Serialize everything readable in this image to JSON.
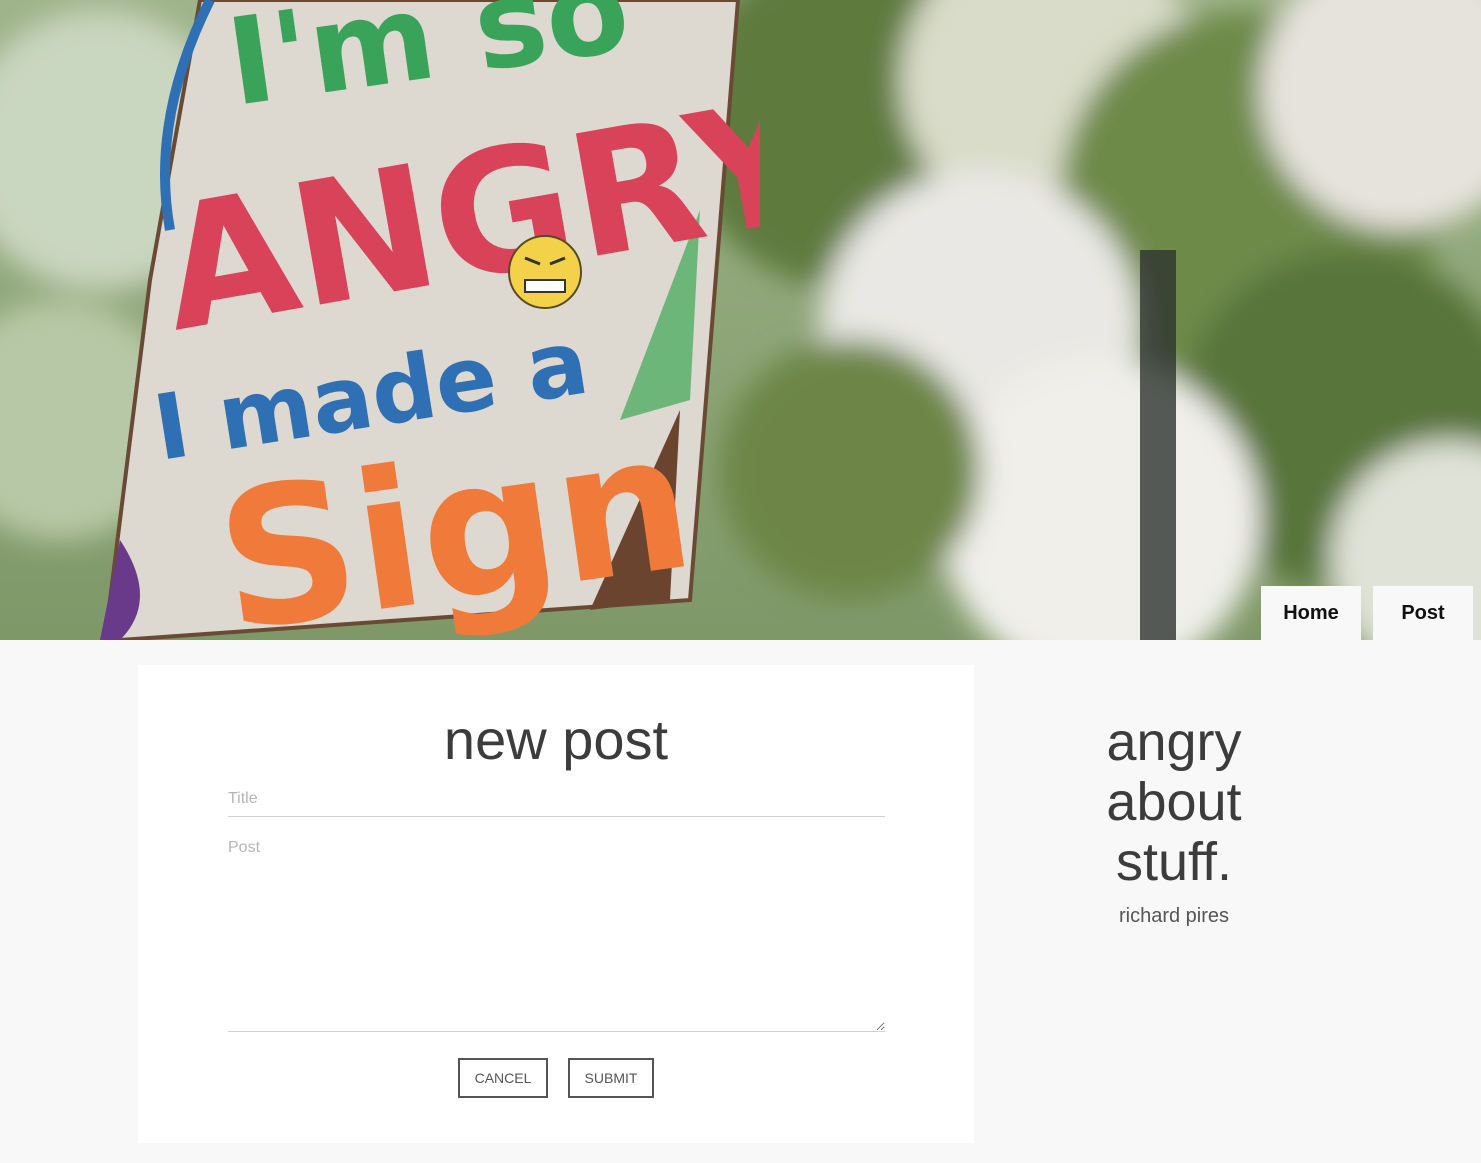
{
  "hero": {
    "image_description": "",
    "sign_lines": [
      "I'm so",
      "ANGRY",
      "I made a",
      "Sign"
    ]
  },
  "nav": {
    "home_label": "Home",
    "post_label": "Post"
  },
  "form": {
    "heading": "new post",
    "title_placeholder": "Title",
    "post_placeholder": "Post",
    "cancel_label": "CANCEL",
    "submit_label": "SUBMIT"
  },
  "sidebar": {
    "brand_lines": [
      "angry",
      "about",
      "stuff."
    ],
    "author": "richard pires"
  },
  "colors": {
    "page_bg": "#f8f8f8",
    "card_bg": "#ffffff",
    "text_dark": "#3c3c3c",
    "sign_red": "#d9435a",
    "sign_green": "#3aa35a",
    "sign_blue": "#2f6fb3",
    "sign_orange": "#f07a3a"
  }
}
